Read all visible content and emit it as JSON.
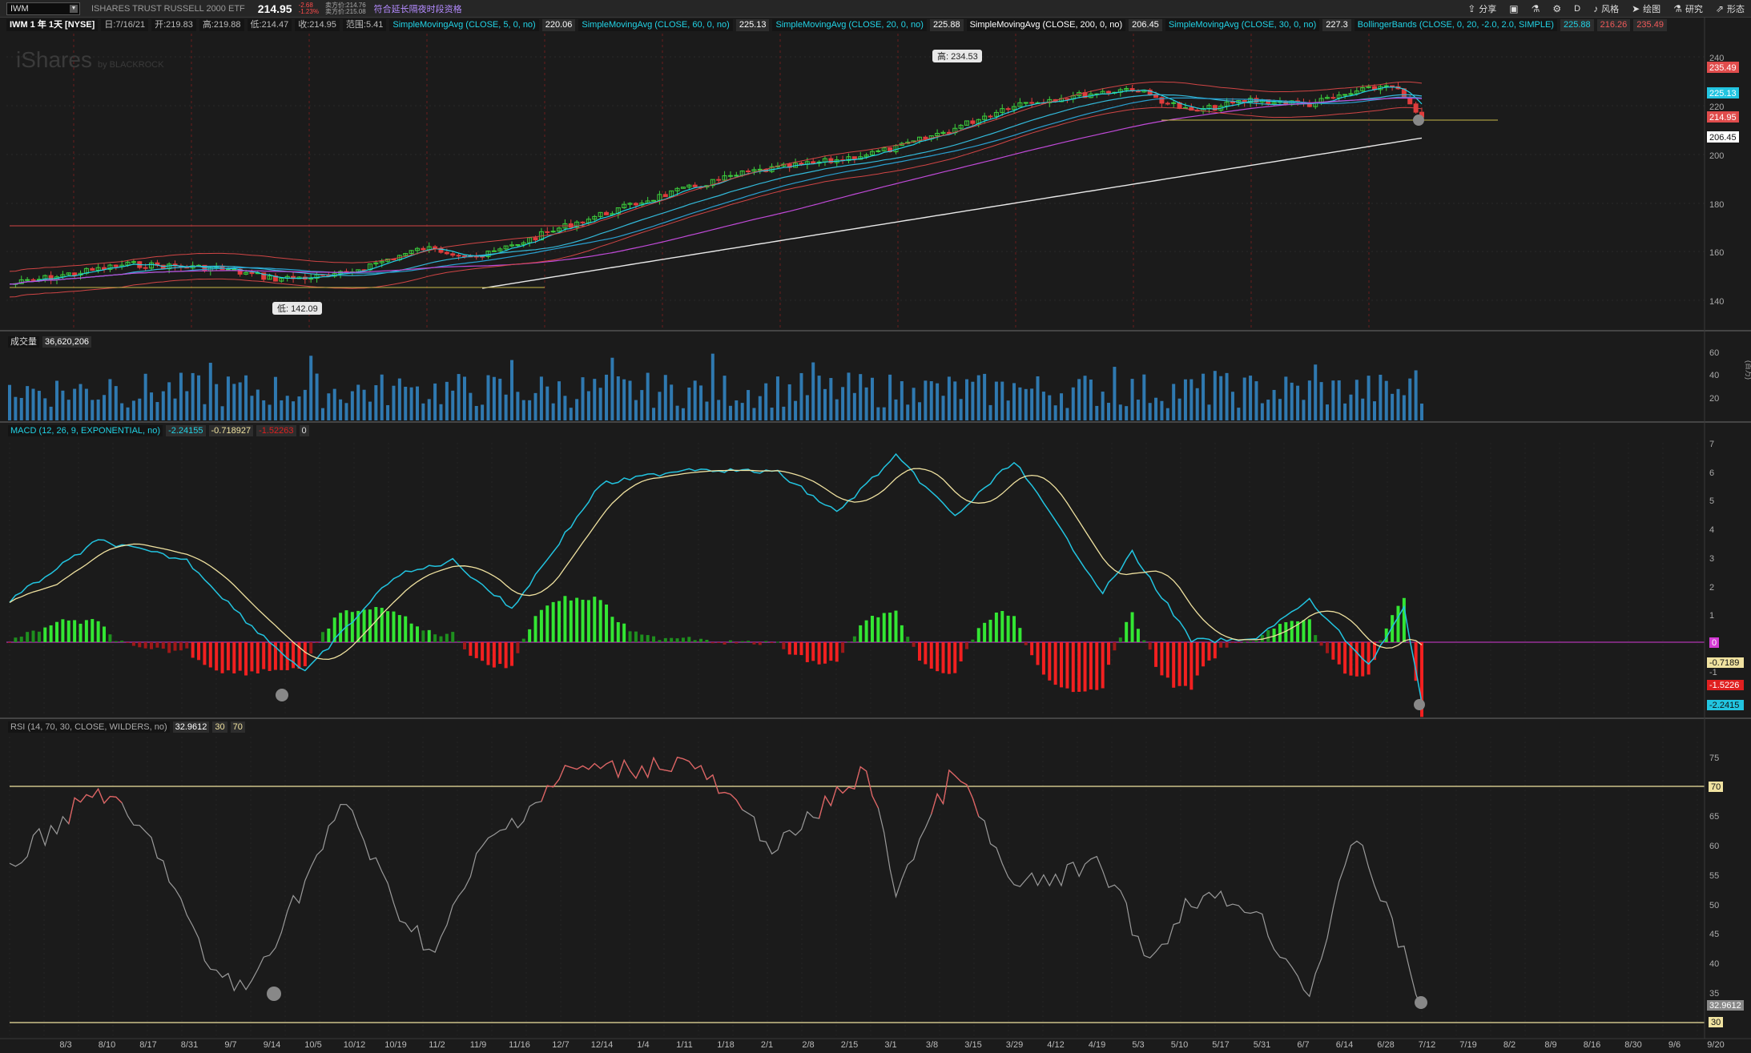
{
  "toolbar": {
    "symbol": "IWM",
    "name": "ISHARES TRUST RUSSELL 2000 ETF",
    "last": "214.95",
    "change": "-2.68",
    "change_pct": "-1.23%",
    "bid": "卖方价:214.76",
    "ask": "卖方价:215.08",
    "promo": "符合延长隔夜时段资格",
    "tools": [
      {
        "icon": "share-icon",
        "label": "分享"
      },
      {
        "icon": "display-icon",
        "label": ""
      },
      {
        "icon": "flask-icon",
        "label": ""
      },
      {
        "icon": "gear-icon",
        "label": ""
      },
      {
        "icon": "d-icon",
        "label": "D"
      },
      {
        "icon": "style-icon",
        "label": "风格"
      },
      {
        "icon": "cursor-icon",
        "label": "绘图"
      },
      {
        "icon": "research-icon",
        "label": "研究"
      },
      {
        "icon": "pattern-icon",
        "label": "形态"
      }
    ]
  },
  "study_line": {
    "title": "IWM 1 年 1天 [NYSE]",
    "date": "日:7/16/21",
    "open": "开:219.83",
    "high": "高:219.88",
    "low": "低:214.47",
    "close": "收:214.95",
    "range": "范围:5.41",
    "studies": [
      {
        "label": "SimpleMovingAvg (CLOSE, 5, 0, no)",
        "value": "220.06",
        "color": "#22d3e6"
      },
      {
        "label": "SimpleMovingAvg (CLOSE, 60, 0, no)",
        "value": "225.13",
        "color": "#22d3e6"
      },
      {
        "label": "SimpleMovingAvg (CLOSE, 20, 0, no)",
        "value": "225.88",
        "color": "#22d3e6"
      },
      {
        "label": "SimpleMovingAvg (CLOSE, 200, 0, no)",
        "value": "206.45",
        "color": "#ffffff"
      },
      {
        "label": "SimpleMovingAvg (CLOSE, 30, 0, no)",
        "value": "227.3",
        "color": "#22d3e6"
      },
      {
        "label": "BollingerBands (CLOSE, 0, 20, -2.0, 2.0, SIMPLE)",
        "value": "225.88",
        "value2": "216.26",
        "value3": "235.49",
        "color": "#22d3e6"
      }
    ]
  },
  "watermark": "iShares",
  "watermark_sub": "by BLACKROCK",
  "price_panel": {
    "high_label": "高: 234.53",
    "low_label": "低: 142.09",
    "y_ticks": [
      "240",
      "220",
      "200",
      "180",
      "160",
      "140"
    ],
    "right_tags": [
      {
        "label": "235.49",
        "color": "#e04c4c"
      },
      {
        "label": "225.13",
        "color": "#22c4e0"
      },
      {
        "label": "214.95",
        "color": "#e04c4c"
      },
      {
        "label": "206.45",
        "color": "#ffffff"
      }
    ]
  },
  "volume_panel": {
    "label": "成交量",
    "value": "36,620,206",
    "y_ticks": [
      "60",
      "40",
      "20"
    ],
    "unit": "(百万)"
  },
  "macd_panel": {
    "label": "MACD (12, 26, 9, EXPONENTIAL, no)",
    "v1": "-2.24155",
    "v2": "-0.718927",
    "v3": "-1.52263",
    "v4": "0",
    "y_ticks": [
      "7",
      "6",
      "5",
      "4",
      "3",
      "2",
      "1",
      "-1"
    ],
    "right_tags": [
      {
        "label": "0",
        "color": "#d63bd6"
      },
      {
        "label": "-0.7189",
        "color": "#f0e2a0"
      },
      {
        "label": "-1.5226",
        "color": "#e02020"
      },
      {
        "label": "-2.2415",
        "color": "#22c4e0"
      }
    ]
  },
  "rsi_panel": {
    "label": "RSI (14, 70, 30, CLOSE, WILDERS, no)",
    "value": "32.9612",
    "low": "30",
    "high": "70",
    "y_ticks": [
      "75",
      "65",
      "60",
      "55",
      "50",
      "45",
      "40",
      "35"
    ],
    "right_tags": [
      {
        "label": "70",
        "color": "#f0e2a0"
      },
      {
        "label": "32.9612",
        "color": "#888888"
      },
      {
        "label": "30",
        "color": "#f0e2a0"
      }
    ]
  },
  "x_labels": [
    "8/3",
    "8/10",
    "8/17",
    "8/31",
    "9/7",
    "9/14",
    "10/5",
    "10/12",
    "10/19",
    "11/2",
    "11/9",
    "11/16",
    "12/7",
    "12/14",
    "1/4",
    "1/11",
    "1/18",
    "2/1",
    "2/8",
    "2/15",
    "3/1",
    "3/8",
    "3/15",
    "3/29",
    "4/12",
    "4/19",
    "5/3",
    "5/10",
    "5/17",
    "5/31",
    "6/7",
    "6/14",
    "6/28",
    "7/12",
    "7/19",
    "8/2",
    "8/9",
    "8/16",
    "8/30",
    "9/6",
    "9/20"
  ]
}
